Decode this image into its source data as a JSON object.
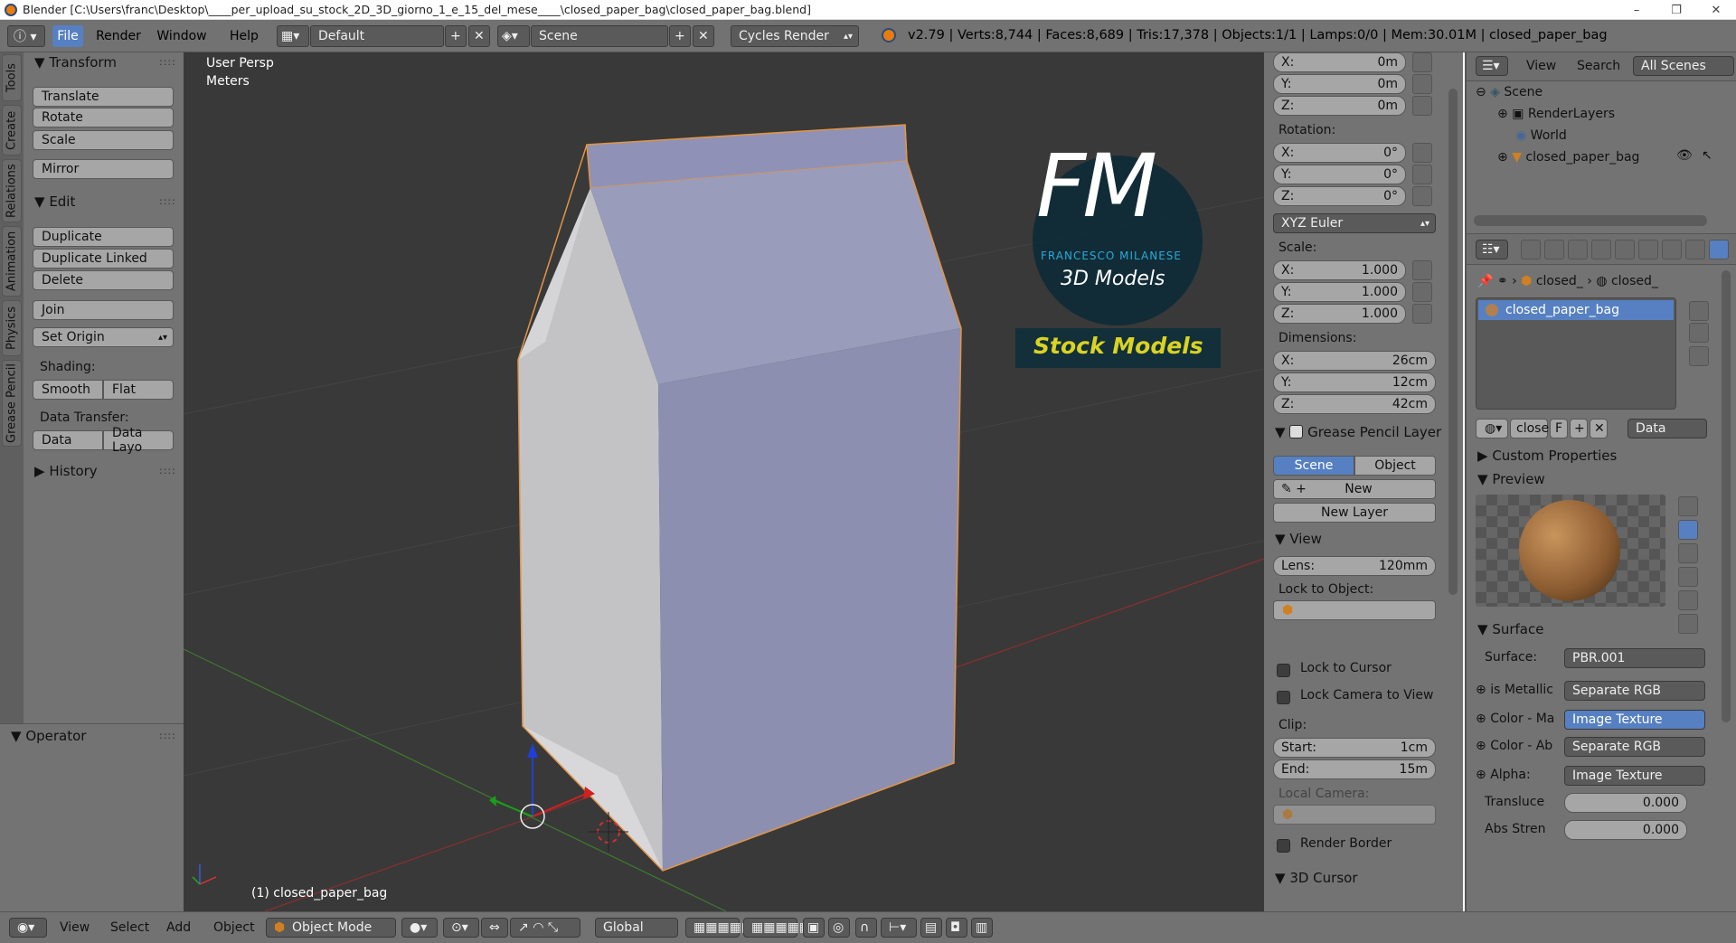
{
  "window": {
    "title": "Blender [C:\\Users\\franc\\Desktop\\____per_upload_su_stock_2D_3D_giorno_1_e_15_del_mese____\\closed_paper_bag\\closed_paper_bag.blend]",
    "controls": [
      "–",
      "❐",
      "✕"
    ]
  },
  "header": {
    "menus": [
      "File",
      "Render",
      "Window",
      "Help"
    ],
    "layout": "Default",
    "scene": "Scene",
    "engine": "Cycles Render",
    "stats": "v2.79 | Verts:8,744 | Faces:8,689 | Tris:17,378 | Objects:1/1 | Lamps:0/0 | Mem:30.01M | closed_paper_bag"
  },
  "toolshelf": {
    "tabs": [
      "Tools",
      "Create",
      "Relations",
      "Animation",
      "Physics",
      "Grease Pencil"
    ],
    "transform": {
      "title": "Transform",
      "buttons": [
        "Translate",
        "Rotate",
        "Scale",
        "Mirror"
      ]
    },
    "edit": {
      "title": "Edit",
      "duplicate": "Duplicate",
      "duplicate_linked": "Duplicate Linked",
      "delete": "Delete",
      "join": "Join",
      "set_origin": "Set Origin",
      "shading_label": "Shading:",
      "smooth": "Smooth",
      "flat": "Flat",
      "data_transfer_label": "Data Transfer:",
      "data": "Data",
      "data_layo": "Data Layo"
    },
    "history": "History",
    "operator": "Operator"
  },
  "viewport": {
    "view_label": "User Persp",
    "units_label": "Meters",
    "object_label": "(1) closed_paper_bag",
    "watermark_logo": "FM",
    "watermark_name": "FRANCESCO MILANESE",
    "watermark_sub": "3D Models",
    "watermark_stock": "Stock Models"
  },
  "properties_n": {
    "location": [
      {
        "axis": "X:",
        "value": "0m"
      },
      {
        "axis": "Y:",
        "value": "0m"
      },
      {
        "axis": "Z:",
        "value": "0m"
      }
    ],
    "rotation_label": "Rotation:",
    "rotation": [
      {
        "axis": "X:",
        "value": "0°"
      },
      {
        "axis": "Y:",
        "value": "0°"
      },
      {
        "axis": "Z:",
        "value": "0°"
      }
    ],
    "rotation_mode": "XYZ Euler",
    "scale_label": "Scale:",
    "scale": [
      {
        "axis": "X:",
        "value": "1.000"
      },
      {
        "axis": "Y:",
        "value": "1.000"
      },
      {
        "axis": "Z:",
        "value": "1.000"
      }
    ],
    "dimensions_label": "Dimensions:",
    "dimensions": [
      {
        "axis": "X:",
        "value": "26cm"
      },
      {
        "axis": "Y:",
        "value": "12cm"
      },
      {
        "axis": "Z:",
        "value": "42cm"
      }
    ],
    "grease_pencil": {
      "title": "Grease Pencil Layer",
      "scene": "Scene",
      "object": "Object",
      "new": "New",
      "new_layer": "New Layer"
    },
    "view": {
      "title": "View",
      "lens_label": "Lens:",
      "lens_value": "120mm",
      "lock_object": "Lock to Object:",
      "lock_cursor": "Lock to Cursor",
      "lock_camera": "Lock Camera to View",
      "clip_label": "Clip:",
      "start_label": "Start:",
      "start_value": "1cm",
      "end_label": "End:",
      "end_value": "15m",
      "local_camera": "Local Camera:",
      "render_border": "Render Border"
    },
    "cursor_title": "3D Cursor"
  },
  "outliner": {
    "menus": [
      "View",
      "Search"
    ],
    "filter": "All Scenes",
    "items": [
      "Scene",
      "RenderLayers",
      "World",
      "closed_paper_bag"
    ]
  },
  "properties": {
    "breadcrumb": [
      "closed_",
      "closed_"
    ],
    "material_slot": "closed_paper_bag",
    "material_name": "close",
    "fake_user": "F",
    "link": "Data",
    "custom_properties": "Custom Properties",
    "preview": "Preview",
    "surface_title": "Surface",
    "surface_label": "Surface:",
    "surface_value": "PBR.001",
    "inputs": [
      {
        "label": "is Metallic",
        "value": "Separate RGB",
        "style": "dark"
      },
      {
        "label": "Color - Ma",
        "value": "Image Texture",
        "style": "blue"
      },
      {
        "label": "Color - Ab",
        "value": "Separate RGB",
        "style": "dark"
      },
      {
        "label": "Alpha:",
        "value": "Image Texture",
        "style": "dark"
      }
    ],
    "translucent_label": "Transluce",
    "translucent_value": "0.000",
    "abs_label": "Abs Stren",
    "abs_value": "0.000"
  },
  "bottombar": {
    "menus": [
      "View",
      "Select",
      "Add",
      "Object"
    ],
    "mode": "Object Mode",
    "orientation": "Global"
  }
}
